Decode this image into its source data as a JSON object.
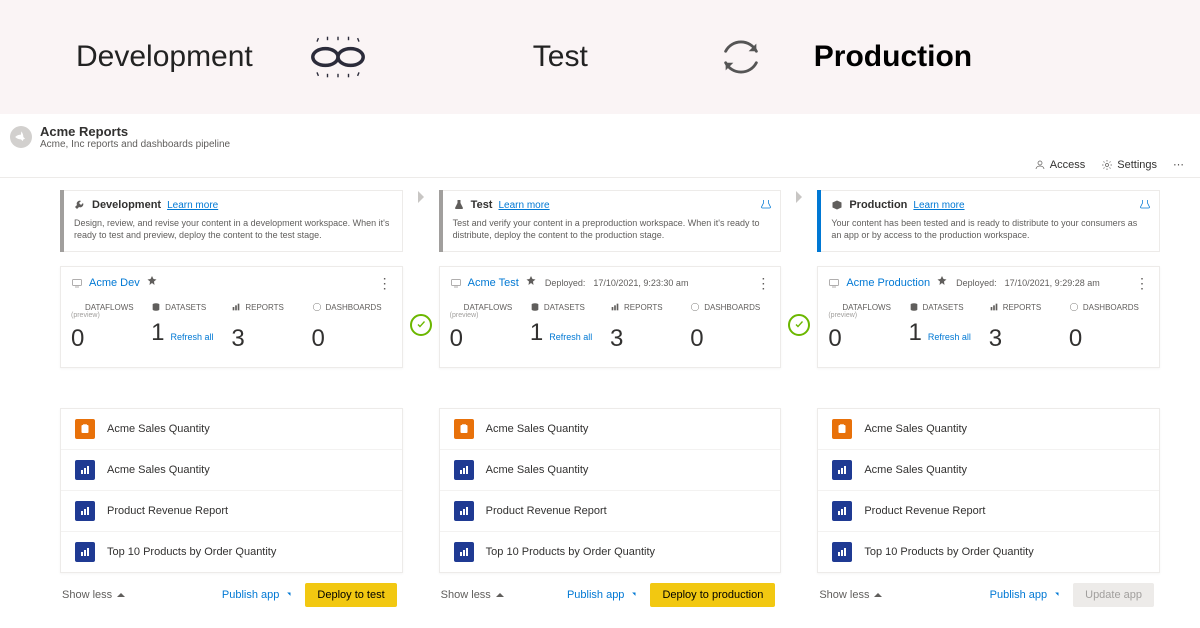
{
  "banner": {
    "development": "Development",
    "test": "Test",
    "production": "Production"
  },
  "pipeline": {
    "title": "Acme Reports",
    "subtitle": "Acme, Inc reports and dashboards pipeline"
  },
  "toolbar": {
    "access": "Access",
    "settings": "Settings"
  },
  "stages": {
    "dev": {
      "title": "Development",
      "learn_more": "Learn more",
      "desc": "Design, review, and revise your content in a development workspace. When it's ready to test and preview, deploy the content to the test stage."
    },
    "test": {
      "title": "Test",
      "learn_more": "Learn more",
      "desc": "Test and verify your content in a preproduction workspace. When it's ready to distribute, deploy the content to the production stage."
    },
    "prod": {
      "title": "Production",
      "learn_more": "Learn more",
      "desc": "Your content has been tested and is ready to distribute to your consumers as an app or by access to the production workspace."
    }
  },
  "workspaces": {
    "dev": {
      "name": "Acme Dev",
      "deployed_label": "",
      "deployed_time": ""
    },
    "test": {
      "name": "Acme Test",
      "deployed_label": "Deployed:",
      "deployed_time": "17/10/2021, 9:23:30 am"
    },
    "prod": {
      "name": "Acme Production",
      "deployed_label": "Deployed:",
      "deployed_time": "17/10/2021, 9:29:28 am"
    }
  },
  "count_labels": {
    "dataflows": "DATAFLOWS",
    "dataflows_sub": "(preview)",
    "datasets": "DATASETS",
    "reports": "REPORTS",
    "dashboards": "DASHBOARDS",
    "refresh_all": "Refresh all"
  },
  "counts": {
    "dev": {
      "dataflows": "0",
      "datasets": "1",
      "reports": "3",
      "dashboards": "0"
    },
    "test": {
      "dataflows": "0",
      "datasets": "1",
      "reports": "3",
      "dashboards": "0"
    },
    "prod": {
      "dataflows": "0",
      "datasets": "1",
      "reports": "3",
      "dashboards": "0"
    }
  },
  "items": [
    {
      "icon": "orange",
      "name": "Acme Sales Quantity"
    },
    {
      "icon": "blue",
      "name": "Acme Sales Quantity"
    },
    {
      "icon": "blue",
      "name": "Product Revenue Report"
    },
    {
      "icon": "blue",
      "name": "Top 10 Products by Order Quantity"
    }
  ],
  "footer": {
    "show_less": "Show less",
    "publish_app": "Publish app",
    "deploy_test": "Deploy to test",
    "deploy_prod": "Deploy to production",
    "update_app": "Update app"
  }
}
